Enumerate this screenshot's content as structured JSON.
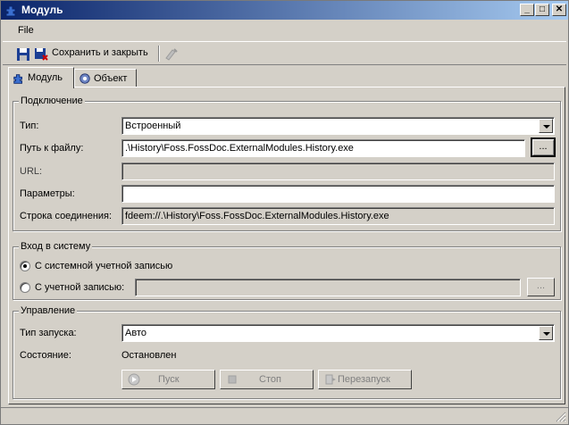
{
  "window": {
    "title": "Модуль",
    "minimize_glyph": "_",
    "maximize_glyph": "□",
    "close_glyph": "✕"
  },
  "menu": {
    "file": "File"
  },
  "toolbar": {
    "save_close_label": "Сохранить и закрыть",
    "save_icon": "floppy-disk-icon",
    "disabled_tool_icon": "tool-icon"
  },
  "tabs": [
    {
      "label": "Модуль",
      "icon": "puzzle-icon",
      "active": true
    },
    {
      "label": "Объект",
      "icon": "gear-icon",
      "active": false
    }
  ],
  "connection": {
    "title": "Подключение",
    "type_label": "Тип:",
    "type_value": "Встроенный",
    "path_label": "Путь к файлу:",
    "path_value": ".\\History\\Foss.FossDoc.ExternalModules.History.exe",
    "browse_label": "...",
    "url_label": "URL:",
    "url_value": "",
    "params_label": "Параметры:",
    "params_value": "",
    "conn_string_label": "Строка соединения:",
    "conn_string_value": "fdeem://.\\History\\Foss.FossDoc.ExternalModules.History.exe"
  },
  "login": {
    "title": "Вход в систему",
    "system_account_label": "С системной учетной записью",
    "system_account_checked": true,
    "account_label": "С учетной записью:",
    "account_checked": false,
    "account_value": "",
    "account_browse_label": "..."
  },
  "control": {
    "title": "Управление",
    "startup_type_label": "Тип запуска:",
    "startup_type_value": "Авто",
    "state_label": "Состояние:",
    "state_value": "Остановлен",
    "start_label": "Пуск",
    "stop_label": "Стоп",
    "restart_label": "Перезапуск"
  },
  "colors": {
    "titlebar_start": "#0a246a",
    "titlebar_end": "#a6caf0",
    "face": "#d4d0c8"
  }
}
